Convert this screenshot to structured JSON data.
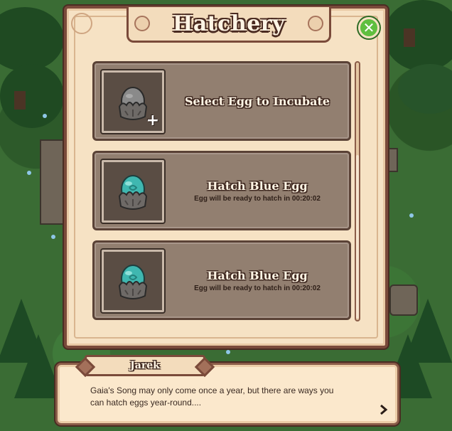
{
  "hatchery": {
    "title": "Hatchery",
    "slots": [
      {
        "title": "Select Egg to Incubate",
        "subtitle": "",
        "icon": "empty-incubator-icon",
        "action_icon": "+"
      },
      {
        "title": "Hatch Blue Egg",
        "subtitle": "Egg will be ready to hatch in 00:20:02",
        "icon": "blue-egg-icon"
      },
      {
        "title": "Hatch Blue Egg",
        "subtitle": "Egg will be ready to hatch in 00:20:02",
        "icon": "blue-egg-icon"
      }
    ]
  },
  "dialog": {
    "speaker": "Jarek",
    "line1": "Gaia's Song may only come once a year, but there are ways you",
    "line2": "can hatch eggs year-round...."
  },
  "colors": {
    "panel_bg": "#f6e2c4",
    "slot_bg": "#927f70",
    "close_button": "#5fbf3f",
    "blue_egg": "#3fb7b0",
    "empty_egg": "#8a8a8a"
  }
}
